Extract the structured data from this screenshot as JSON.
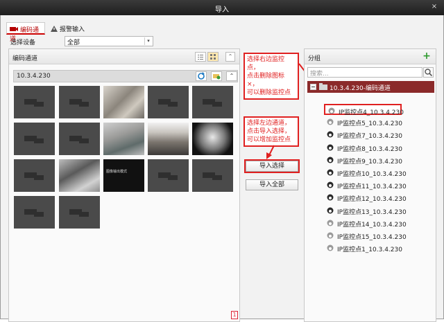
{
  "window": {
    "title": "导入",
    "close": "×"
  },
  "tabs": [
    {
      "label": "编码通道"
    },
    {
      "label": "报警输入"
    }
  ],
  "device_select": {
    "label": "选择设备",
    "value": "全部"
  },
  "left_panel": {
    "title": "编码通道",
    "ip": "10.3.4.230",
    "page": "1",
    "osd_text": "图像输出模式"
  },
  "buttons": {
    "import_selected": "导入选择",
    "import_all": "导入全部"
  },
  "notes": {
    "right_note": [
      "选择右边监控点，",
      "点击删除图标×，",
      "可以删除监控点"
    ],
    "left_note": [
      "选择左边通道，",
      "点击导入选择，",
      "可以增加监控点"
    ]
  },
  "right_panel": {
    "title": "分组",
    "search_placeholder": "搜索...",
    "group": "10.3.4.230-编码通道",
    "items": [
      {
        "label": "IP监控点4_10.3.4.230",
        "icon": "dome-camera-icon"
      },
      {
        "label": "IP监控点5_10.3.4.230",
        "icon": "dome-camera-icon"
      },
      {
        "label": "IP监控点7_10.3.4.230",
        "icon": "dark-dome-icon"
      },
      {
        "label": "IP监控点8_10.3.4.230",
        "icon": "dark-dome-icon"
      },
      {
        "label": "IP监控点9_10.3.4.230",
        "icon": "dark-dome-icon"
      },
      {
        "label": "IP监控点10_10.3.4.230",
        "icon": "dark-dome-icon"
      },
      {
        "label": "IP监控点11_10.3.4.230",
        "icon": "dark-dome-icon"
      },
      {
        "label": "IP监控点12_10.3.4.230",
        "icon": "dark-dome-icon"
      },
      {
        "label": "IP监控点13_10.3.4.230",
        "icon": "dark-dome-icon"
      },
      {
        "label": "IP监控点14_10.3.4.230",
        "icon": "dome-camera-icon"
      },
      {
        "label": "IP监控点15_10.3.4.230",
        "icon": "dome-camera-icon"
      },
      {
        "label": "IP监控点1_10.3.4.230",
        "icon": "dome-camera-icon"
      }
    ]
  },
  "colors": {
    "accent": "#c00000",
    "annotation": "#e02020",
    "group_bg": "#8b2a2a"
  }
}
